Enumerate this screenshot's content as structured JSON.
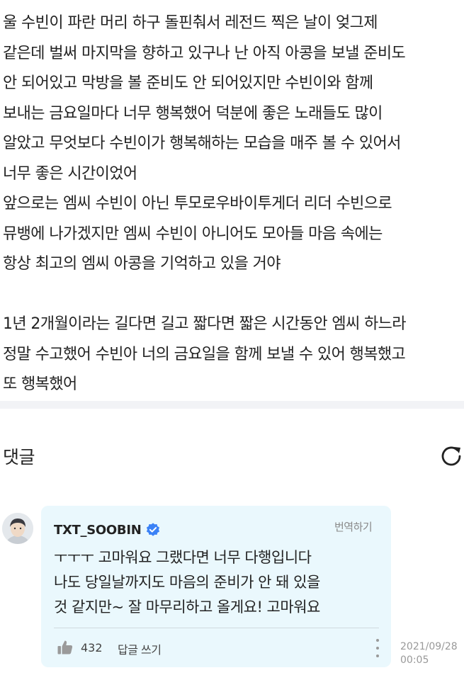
{
  "post": {
    "lines": [
      "울 수빈이 파란 머리 하구 돌핀춰서 레전드 찍은 날이 엊그제",
      "같은데 벌써 마지막을 향하고 있구나 난 아직 아콩을 보낼 준비도",
      "안 되어있고 막방을 볼 준비도 안 되어있지만 수빈이와 함께",
      "보내는 금요일마다 너무 행복했어 덕분에 좋은 노래들도 많이",
      "알았고 무엇보다 수빈이가 행복해하는 모습을 매주 볼 수 있어서",
      "너무 좋은 시간이었어",
      "앞으로는 엠씨 수빈이 아닌 투모로우바이투게더 리더 수빈으로",
      "뮤뱅에 나가겠지만 엠씨 수빈이 아니어도 모아들 마음 속에는",
      "항상 최고의 엠씨 아콩을 기억하고 있을 거야",
      "",
      "1년 2개월이라는 길다면 길고 짧다면 짧은 시간동안 엠씨 하느라",
      "정말 수고했어 수빈아 너의 금요일을 함께 보낼 수 있어 행복했고",
      "또 행복했어"
    ]
  },
  "comments": {
    "title": "댓글",
    "refresh_icon": "refresh-icon"
  },
  "comment": {
    "author": "TXT_SOOBIN",
    "verified_icon": "verified-badge-icon",
    "translate_label": "번역하기",
    "body_lines": [
      "ㅜㅜㅜ 고마워요 그랬다면 너무 다행입니다",
      "나도 당일날까지도 마음의 준비가 안 돼 있을",
      "것 같지만~ 잘 마무리하고 올게요! 고마워요"
    ],
    "like_icon": "thumbs-up-icon",
    "like_count": "432",
    "reply_label": "답글 쓰기",
    "more_icon": "more-vertical-icon",
    "date": "2021/09/28",
    "time": "00:05"
  },
  "colors": {
    "bubble": "#eaf8fd",
    "verified": "#3b82f6",
    "divider": "#f2f3f6"
  }
}
